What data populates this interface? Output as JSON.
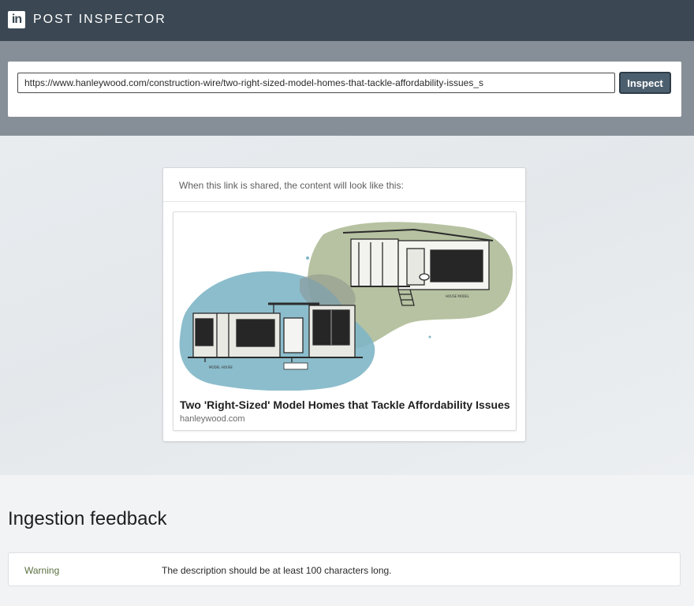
{
  "header": {
    "logo_text": "in",
    "title": "POST INSPECTOR"
  },
  "search": {
    "url_value": "https://www.hanleywood.com/construction-wire/two-right-sized-model-homes-that-tackle-affordability-issues_s",
    "inspect_label": "Inspect"
  },
  "preview": {
    "caption": "When this link is shared, the content will look like this:",
    "card": {
      "image_description_icon": "model-homes-illustration",
      "title": "Two 'Right-Sized' Model Homes that Tackle Affordability Issues",
      "domain": "hanleywood.com"
    }
  },
  "feedback": {
    "heading": "Ingestion feedback",
    "rows": [
      {
        "level": "Warning",
        "message": "The description should be at least 100 characters long."
      }
    ]
  },
  "colors": {
    "header_bg": "#3b4853",
    "band_bg": "#868f97",
    "button_bg": "#4c5f6e",
    "warning_text": "#5b7040",
    "illustration_green": "#a9b790",
    "illustration_blue": "#7fb6c6"
  }
}
